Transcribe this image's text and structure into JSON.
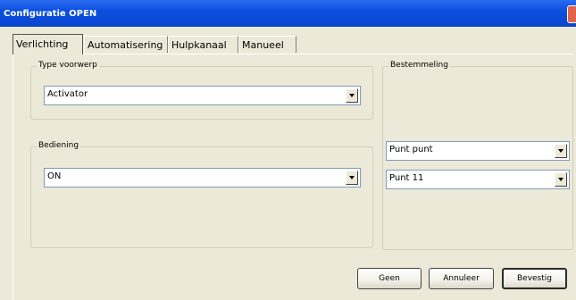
{
  "window": {
    "title": "Configuratie OPEN"
  },
  "tabs": [
    {
      "label": "Verlichting",
      "active": true
    },
    {
      "label": "Automatisering",
      "active": false
    },
    {
      "label": "Hulpkanaal",
      "active": false
    },
    {
      "label": "Manueel",
      "active": false
    }
  ],
  "type_voorwerp": {
    "label": "Type voorwerp",
    "value": "Activator"
  },
  "bediening": {
    "label": "Bediening",
    "value": "ON"
  },
  "bestemmeling": {
    "label": "Bestemmeling",
    "combo1_value": "Punt punt",
    "combo2_value": "Punt 11"
  },
  "buttons": {
    "geen": "Geen",
    "annuleer": "Annuleer",
    "bevestig": "Bevestig"
  },
  "colors": {
    "titlebar": "#0b4fdf",
    "window_bg": "#ece9d8",
    "combo_border": "#7f9db9"
  }
}
